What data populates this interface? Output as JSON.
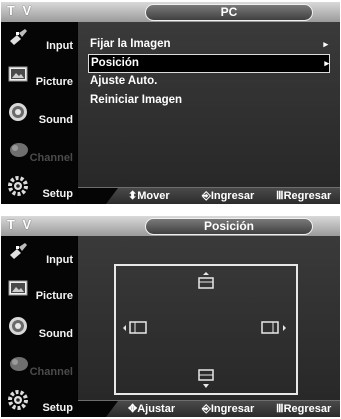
{
  "screen1": {
    "tv_label": "T V",
    "title": "PC",
    "sidebar": [
      {
        "label": "Input",
        "icon": "input-plug-icon",
        "enabled": true
      },
      {
        "label": "Picture",
        "icon": "picture-icon",
        "enabled": true
      },
      {
        "label": "Sound",
        "icon": "sound-icon",
        "enabled": true
      },
      {
        "label": "Channel",
        "icon": "channel-satellite-icon",
        "enabled": false
      },
      {
        "label": "Setup",
        "icon": "setup-gear-icon",
        "enabled": true
      }
    ],
    "menu": [
      {
        "label": "Fijar la Imagen",
        "arrow": "▸",
        "selected": false
      },
      {
        "label": "Posición",
        "arrow": "▸",
        "selected": true
      },
      {
        "label": "Ajuste Auto.",
        "arrow": "",
        "selected": false
      },
      {
        "label": "Reiniciar Imagen",
        "arrow": "",
        "selected": false
      }
    ],
    "bottom": {
      "move": "⬍Mover",
      "enter": "Ingresar",
      "return": "Regresar"
    }
  },
  "screen2": {
    "tv_label": "T V",
    "title": "Posición",
    "sidebar": [
      {
        "label": "Input",
        "icon": "input-plug-icon",
        "enabled": true
      },
      {
        "label": "Picture",
        "icon": "picture-icon",
        "enabled": true
      },
      {
        "label": "Sound",
        "icon": "sound-icon",
        "enabled": true
      },
      {
        "label": "Channel",
        "icon": "channel-satellite-icon",
        "enabled": false
      },
      {
        "label": "Setup",
        "icon": "setup-gear-icon",
        "enabled": true
      }
    ],
    "position_icons": [
      "move-up-icon",
      "move-left-icon",
      "move-right-icon",
      "move-down-icon"
    ],
    "bottom": {
      "adjust": "Ajustar",
      "enter": "Ingresar",
      "return": "Regresar"
    }
  }
}
